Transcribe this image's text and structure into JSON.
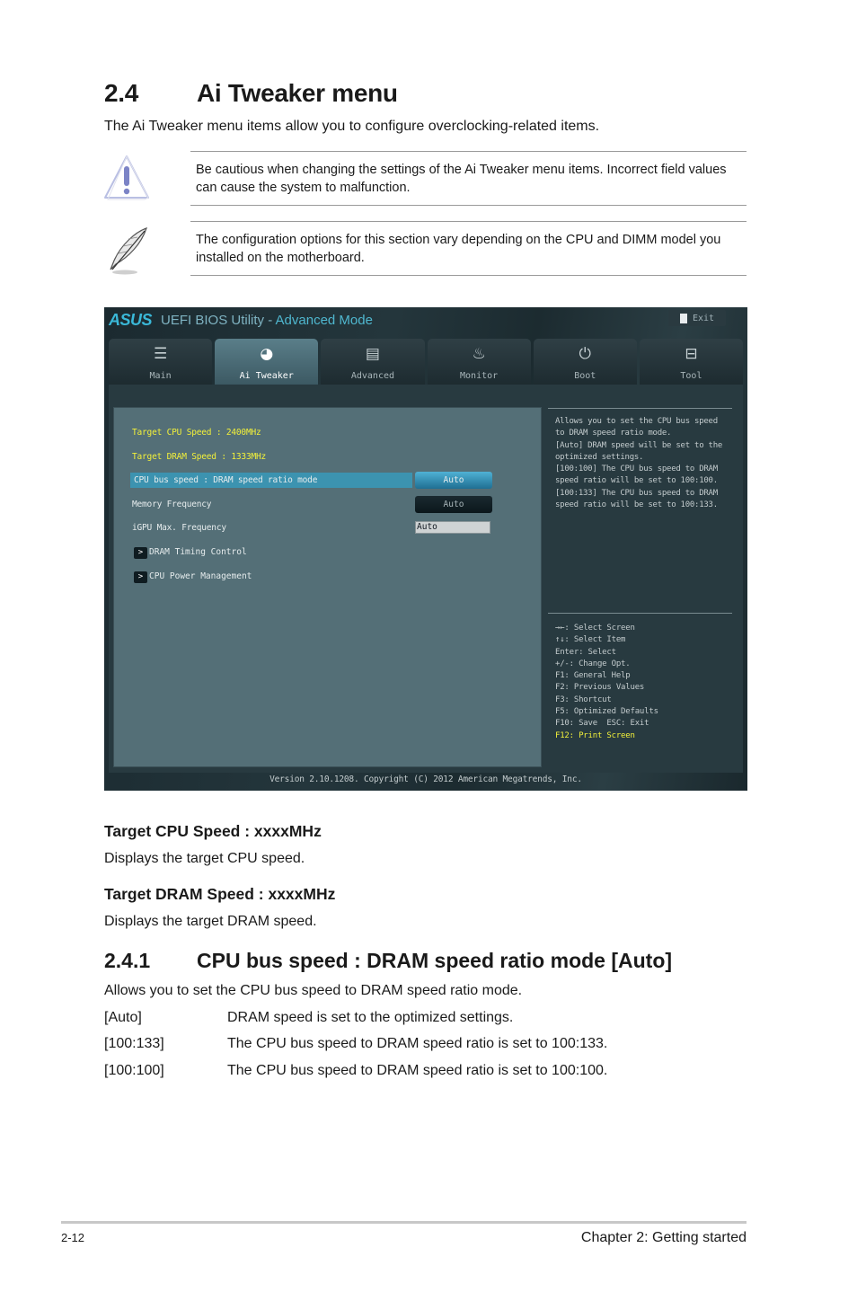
{
  "section": {
    "number": "2.4",
    "title": "Ai Tweaker menu",
    "intro": "The Ai Tweaker menu items allow you to configure overclocking-related items."
  },
  "notes": [
    {
      "icon": "warning-icon",
      "text": "Be cautious when changing the settings of the Ai Tweaker menu items. Incorrect field values can cause the system to malfunction."
    },
    {
      "icon": "note-feather-icon",
      "text": "The configuration options for this section vary depending on the CPU and DIMM model you installed on the motherboard."
    }
  ],
  "bios": {
    "logo": "ASUS",
    "title": "UEFI BIOS Utility - ",
    "mode": "Advanced Mode",
    "exit_label": "Exit",
    "tabs": [
      {
        "label": "Main",
        "icon": "list-icon",
        "glyph": "☰",
        "active": false
      },
      {
        "label": "Ai Tweaker",
        "icon": "ai-tweaker-icon",
        "glyph": "◕",
        "active": true
      },
      {
        "label": "Advanced",
        "icon": "advanced-icon",
        "glyph": "▤",
        "active": false
      },
      {
        "label": "Monitor",
        "icon": "monitor-icon",
        "glyph": "♨",
        "active": false
      },
      {
        "label": "Boot",
        "icon": "power-icon",
        "glyph": "⏻",
        "active": false
      },
      {
        "label": "Tool",
        "icon": "tool-icon",
        "glyph": "⊟",
        "active": false
      }
    ],
    "items": {
      "target_cpu": "Target CPU Speed : 2400MHz",
      "target_dram": "Target DRAM Speed : 1333MHz",
      "ratio_mode": {
        "label": "CPU bus speed : DRAM speed ratio mode",
        "value": "Auto"
      },
      "memory_freq": {
        "label": "Memory Frequency",
        "value": "Auto"
      },
      "igpu_freq": {
        "label": "iGPU Max. Frequency",
        "value": "Auto"
      },
      "dram_timing": {
        "arrow": ">",
        "label": "DRAM Timing Control"
      },
      "cpu_power": {
        "arrow": ">",
        "label": "CPU Power Management"
      }
    },
    "help_text": "Allows you to set the CPU bus speed\nto DRAM speed ratio mode.\n[Auto] DRAM speed will be set to the\noptimized settings.\n[100:100] The CPU bus speed to DRAM\nspeed ratio will be set to 100:100.\n[100:133] The CPU bus speed to DRAM\nspeed ratio will be set to 100:133.",
    "keys": [
      "→←: Select Screen",
      "↑↓: Select Item",
      "Enter: Select",
      "+/-: Change Opt.",
      "F1: General Help",
      "F2: Previous Values",
      "F3: Shortcut",
      "F5: Optimized Defaults",
      "F10: Save  ESC: Exit",
      "F12: Print Screen"
    ],
    "footer": "Version 2.10.1208. Copyright (C) 2012 American Megatrends, Inc."
  },
  "target_cpu": {
    "heading": "Target CPU Speed : xxxxMHz",
    "desc": "Displays the target CPU speed."
  },
  "target_dram": {
    "heading": "Target DRAM Speed : xxxxMHz",
    "desc": "Displays the target DRAM speed."
  },
  "subsection": {
    "number": "2.4.1",
    "title": "CPU bus speed : DRAM speed ratio mode [Auto]",
    "intro": "Allows you to set the CPU bus speed to DRAM speed ratio mode.",
    "options": [
      {
        "key": "[Auto]",
        "desc": "DRAM speed is set to the optimized settings."
      },
      {
        "key": "[100:133]",
        "desc": "The CPU bus speed to DRAM speed ratio is set to 100:133."
      },
      {
        "key": "[100:100]",
        "desc": "The CPU bus speed to DRAM speed ratio is set to 100:100."
      }
    ]
  },
  "footer": {
    "page": "2-12",
    "chapter": "Chapter 2: Getting started"
  }
}
